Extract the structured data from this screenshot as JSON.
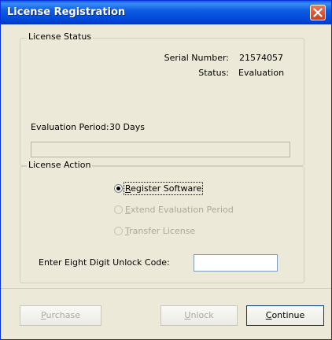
{
  "window": {
    "title": "License Registration"
  },
  "license_status": {
    "legend": "License Status",
    "serial_label": "Serial Number:",
    "serial_value": "21574057",
    "status_label": "Status:",
    "status_value": "Evaluation",
    "period_label": "Evaluation Period:",
    "period_value": "30 Days",
    "progress": 0
  },
  "license_action": {
    "legend": "License Action",
    "options": [
      {
        "first": "R",
        "rest": "egister Software",
        "selected": true,
        "enabled": true
      },
      {
        "first": "E",
        "rest": "xtend Evaluation Period",
        "selected": false,
        "enabled": false
      },
      {
        "first": "T",
        "rest": "ransfer License",
        "selected": false,
        "enabled": false
      }
    ],
    "unlock_label": "Enter Eight Digit Unlock Code:",
    "unlock_value": ""
  },
  "buttons": {
    "purchase": {
      "first": "P",
      "rest": "urchase"
    },
    "unlock": {
      "first": "U",
      "rest": "nlock"
    },
    "continue": {
      "first": "C",
      "rest": "ontinue"
    }
  },
  "colors": {
    "titlebar": "#0a5ce6",
    "dialog_bg": "#ece9d8",
    "close": "#e8785a"
  },
  "icons": {
    "close": "close-x-icon",
    "radio": "radio-dot-icon"
  }
}
